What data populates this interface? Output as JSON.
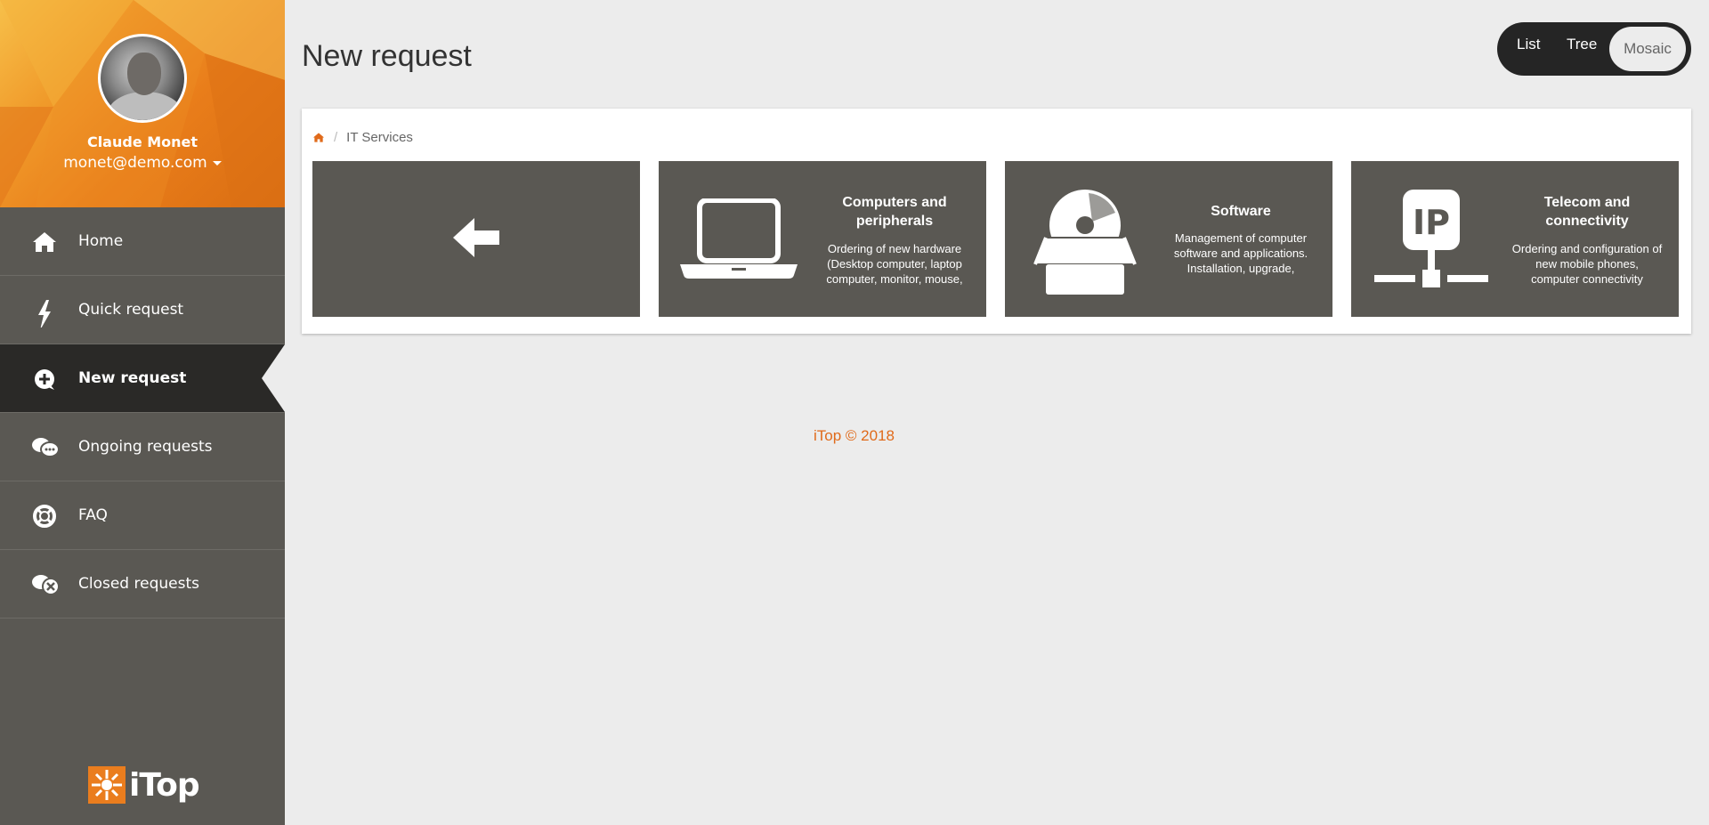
{
  "user": {
    "name": "Claude Monet",
    "email": "monet@demo.com"
  },
  "nav": [
    {
      "label": "Home",
      "icon": "home-icon",
      "active": false
    },
    {
      "label": "Quick request",
      "icon": "lightning-icon",
      "active": false
    },
    {
      "label": "New request",
      "icon": "plus-circle-icon",
      "active": true
    },
    {
      "label": "Ongoing requests",
      "icon": "chat-bubbles-icon",
      "active": false
    },
    {
      "label": "FAQ",
      "icon": "lifebuoy-icon",
      "active": false
    },
    {
      "label": "Closed requests",
      "icon": "chat-closed-icon",
      "active": false
    }
  ],
  "logo": {
    "text": "iTop"
  },
  "page": {
    "title": "New request"
  },
  "view_switch": {
    "list": "List",
    "tree": "Tree",
    "mosaic": "Mosaic",
    "selected": "Mosaic"
  },
  "breadcrumb": {
    "home_icon": "home-icon",
    "current": "IT Services"
  },
  "tiles": [
    {
      "kind": "back",
      "icon": "arrow-left-icon"
    },
    {
      "title": "Computers and peripherals",
      "description": "Ordering of new hardware (Desktop computer, laptop computer, monitor, mouse,",
      "icon": "laptop-icon"
    },
    {
      "title": "Software",
      "description": "Management of computer software and applications. Installation, upgrade,",
      "icon": "software-box-icon"
    },
    {
      "title": "Telecom and connectivity",
      "description": "Ordering and configuration of new mobile phones, computer connectivity",
      "icon": "ip-network-icon"
    }
  ],
  "footer": {
    "text": "iTop © 2018"
  },
  "colors": {
    "accent": "#e97d1a",
    "sidebar": "#5a5853",
    "active": "#2a2927",
    "tile": "#5a5853"
  }
}
